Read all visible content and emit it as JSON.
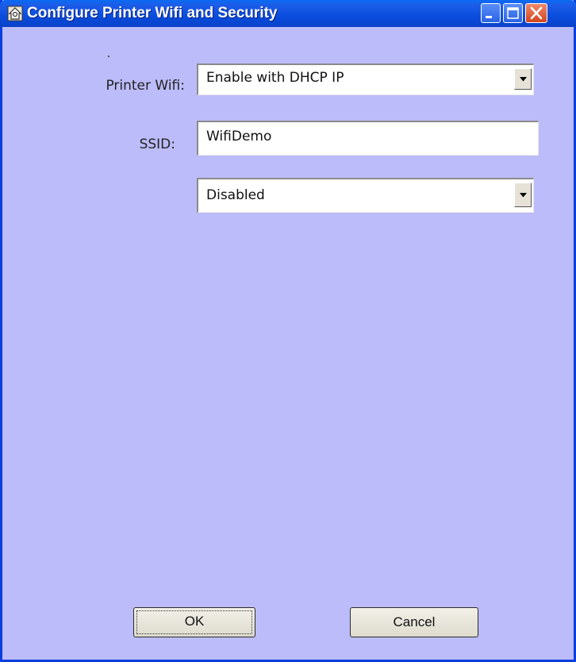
{
  "window": {
    "title": "Configure Printer Wifi and Security",
    "icons": {
      "app": "printer-house-icon",
      "minimize": "minimize-icon",
      "maximize": "maximize-icon",
      "close": "close-icon"
    },
    "colors": {
      "titlebar": "#0a4ddd",
      "client_background": "#bcbcfa",
      "close_button": "#d2441e"
    }
  },
  "form": {
    "printer_wifi": {
      "label": "Printer Wifi:",
      "selected": "Enable with DHCP IP"
    },
    "ssid": {
      "label": "SSID:",
      "value": "WifiDemo"
    },
    "security": {
      "selected": "Disabled"
    }
  },
  "buttons": {
    "ok": "OK",
    "cancel": "Cancel"
  }
}
